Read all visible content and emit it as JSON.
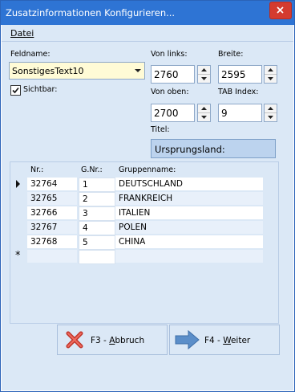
{
  "window": {
    "title": "Zusatzinformationen Konfigurieren..."
  },
  "menu": {
    "datei": "Datei"
  },
  "form": {
    "feldname_label": "Feldname:",
    "feldname_value": "SonstigesText10",
    "sichtbar_label": "Sichtbar:",
    "sichtbar_checked": true,
    "von_links_label": "Von links:",
    "von_links_value": "2760",
    "breite_label": "Breite:",
    "breite_value": "2595",
    "von_oben_label": "Von oben:",
    "von_oben_value": "2700",
    "tab_index_label": "TAB Index:",
    "tab_index_value": "9",
    "titel_label": "Titel:",
    "titel_value": "Ursprungsland:"
  },
  "grid": {
    "columns": [
      "Nr.:",
      "G.Nr.:",
      "Gruppenname:"
    ],
    "rows": [
      {
        "nr": "32764",
        "gnr": "1",
        "name": "DEUTSCHLAND"
      },
      {
        "nr": "32765",
        "gnr": "2",
        "name": "FRANKREICH"
      },
      {
        "nr": "32766",
        "gnr": "3",
        "name": "ITALIEN"
      },
      {
        "nr": "32767",
        "gnr": "4",
        "name": "POLEN"
      },
      {
        "nr": "32768",
        "gnr": "5",
        "name": "CHINA"
      }
    ],
    "new_row_marker": "*"
  },
  "buttons": {
    "abbruch_prefix": "F3 - ",
    "abbruch_mnemonic": "A",
    "abbruch_rest": "bbruch",
    "weiter_prefix": "F4 - ",
    "weiter_mnemonic": "W",
    "weiter_rest": "eiter"
  },
  "colors": {
    "titlebar": "#2e74d4",
    "client": "#dbe8f6",
    "combo_bg": "#fffbd6",
    "titel_bg": "#bcd3ee",
    "close_red": "#d43b2f"
  },
  "icons": {
    "close": "close-icon",
    "combo_arrow": "chevron-down-icon",
    "current_row": "row-pointer-icon",
    "abbruch": "red-x-icon",
    "weiter": "blue-arrow-right-icon"
  }
}
